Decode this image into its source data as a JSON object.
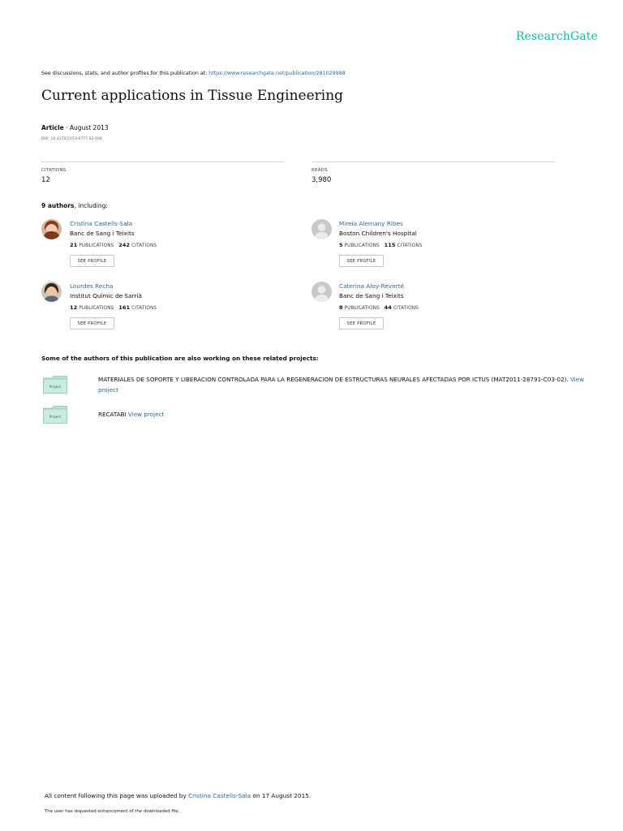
{
  "brand": {
    "logo": "ResearchGate",
    "color": "#14b8a6"
  },
  "discussion": {
    "prefix": "See discussions, stats, and author profiles for this publication at: ",
    "url": "https://www.researchgate.net/publication/281029988"
  },
  "publication": {
    "title": "Current applications in Tissue Engineering",
    "type": "Article",
    "date": " · August 2013",
    "doi": "DOI: 10.4172/2153-0777.S2-004"
  },
  "stats": {
    "citations_label": "CITATIONS",
    "citations_value": "12",
    "reads_label": "READS",
    "reads_value": "3,980"
  },
  "authors": {
    "count": "9 authors",
    "suffix": ", including:",
    "items": [
      {
        "name": "Cristina Castells-Sala",
        "institution": "Banc de Sang i Teixits",
        "publications": "21",
        "citations": "242",
        "pub_label": "PUBLICATIONS",
        "cit_label": "CITATIONS",
        "button": "SEE PROFILE"
      },
      {
        "name": "Mireia Alemany Ribes",
        "institution": "Boston Children's Hospital",
        "publications": "5",
        "citations": "115",
        "pub_label": "PUBLICATIONS",
        "cit_label": "CITATIONS",
        "button": "SEE PROFILE"
      },
      {
        "name": "Lourdes Recha",
        "institution": "Institut Químic de Sarrià",
        "publications": "12",
        "citations": "161",
        "pub_label": "PUBLICATIONS",
        "cit_label": "CITATIONS",
        "button": "SEE PROFILE"
      },
      {
        "name": "Caterina Aloy-Reverté",
        "institution": "Banc de Sang i Teixits",
        "publications": "8",
        "citations": "44",
        "pub_label": "PUBLICATIONS",
        "cit_label": "CITATIONS",
        "button": "SEE PROFILE"
      }
    ]
  },
  "related": {
    "heading": "Some of the authors of this publication are also working on these related projects:",
    "projects": [
      {
        "folder_label": "Project",
        "title": "MATERIALES DE SOPORTE Y LIBERACION CONTROLADA PARA LA REGENERACION DE ESTRUCTURAS NEURALES AFECTADAS POR ICTUS (MAT2011-28791-C03-02). ",
        "link": "View project"
      },
      {
        "folder_label": "Project",
        "title": "RECATABI ",
        "link": "View project"
      }
    ]
  },
  "footer": {
    "uploaded_prefix": "All content following this page was uploaded by ",
    "uploader": "Cristina Castells-Sala",
    "uploaded_suffix": " on 17 August 2015.",
    "note": "The user has requested enhancement of the downloaded file."
  }
}
